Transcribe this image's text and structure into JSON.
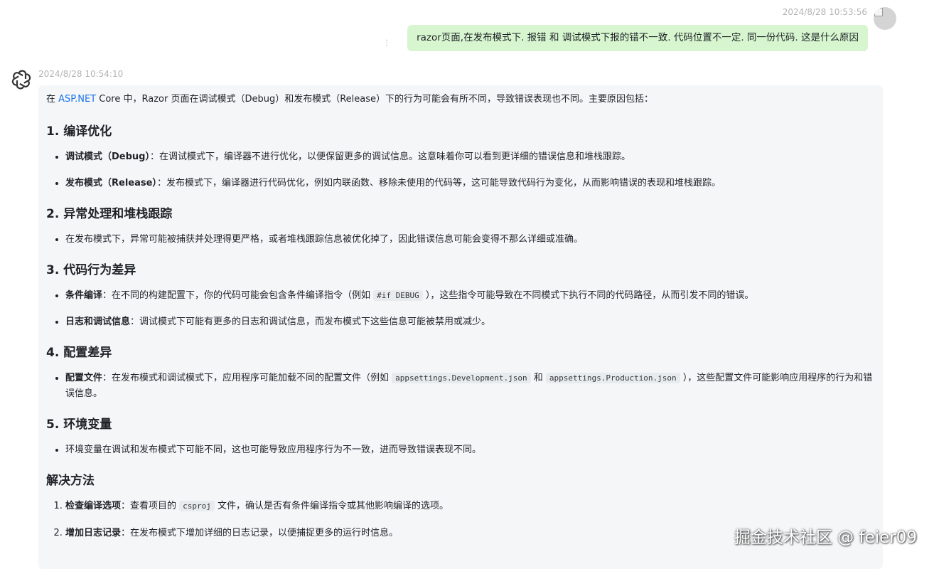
{
  "user_message": {
    "timestamp": "2024/8/28 10:53:56",
    "text": "razor页面,在发布模式下. 报错 和 调试模式下报的错不一致. 代码位置不一定.  同一份代码. 这是什么原因"
  },
  "assistant_message": {
    "timestamp": "2024/8/28 10:54:10",
    "intro": {
      "before": "在 ",
      "link": "ASP.NET",
      "after": " Core 中，Razor 页面在调试模式（Debug）和发布模式（Release）下的行为可能会有所不同，导致错误表现也不同。主要原因包括："
    },
    "sections": [
      {
        "heading": "1. 编译优化",
        "items": [
          {
            "label": "调试模式（Debug）",
            "text": "：在调试模式下，编译器不进行优化，以便保留更多的调试信息。这意味着你可以看到更详细的错误信息和堆栈跟踪。"
          },
          {
            "label": "发布模式（Release）",
            "text": "：发布模式下，编译器进行代码优化，例如内联函数、移除未使用的代码等，这可能导致代码行为变化，从而影响错误的表现和堆栈跟踪。"
          }
        ]
      },
      {
        "heading": "2. 异常处理和堆栈跟踪",
        "items": [
          {
            "text": "在发布模式下，异常可能被捕获并处理得更严格，或者堆栈跟踪信息被优化掉了，因此错误信息可能会变得不那么详细或准确。"
          }
        ]
      },
      {
        "heading": "3. 代码行为差异",
        "items": [
          {
            "label": "条件编译",
            "text_1": "：在不同的构建配置下，你的代码可能会包含条件编译指令（例如 ",
            "code": "#if DEBUG",
            "text_2": " ），这些指令可能导致在不同模式下执行不同的代码路径，从而引发不同的错误。"
          },
          {
            "label": "日志和调试信息",
            "text": "：调试模式下可能有更多的日志和调试信息，而发布模式下这些信息可能被禁用或减少。"
          }
        ]
      },
      {
        "heading": "4. 配置差异",
        "items": [
          {
            "label": "配置文件",
            "text_1": "：在发布模式和调试模式下，应用程序可能加载不同的配置文件（例如 ",
            "code_1": "appsettings.Development.json",
            "text_2": " 和 ",
            "code_2": "appsettings.Production.json",
            "text_3": " ），这些配置文件可能影响应用程序的行为和错误信息。"
          }
        ]
      },
      {
        "heading": "5. 环境变量",
        "items": [
          {
            "text": "环境变量在调试和发布模式下可能不同，这也可能导致应用程序行为不一致，进而导致错误表现不同。"
          }
        ]
      },
      {
        "heading": "解决方法",
        "items": [
          {
            "label": "检查编译选项",
            "text_1": "：查看项目的 ",
            "code": "csproj",
            "text_2": " 文件，确认是否有条件编译指令或其他影响编译的选项。"
          },
          {
            "label": "增加日志记录",
            "text": "：在发布模式下增加详细的日志记录，以便捕捉更多的运行时信息。"
          }
        ]
      }
    ]
  },
  "watermark": "掘金技术社区 @ feier09",
  "colors": {
    "user_bubble": "#d7f6cf",
    "assistant_card": "#f4f6f8",
    "link": "#1a73e8",
    "timestamp": "#b3b3b3"
  },
  "icons": {
    "assistant_avatar": "openai-logo-icon",
    "user_avatar": "broken-image-avatar",
    "message_menu": "more-vertical-icon"
  }
}
